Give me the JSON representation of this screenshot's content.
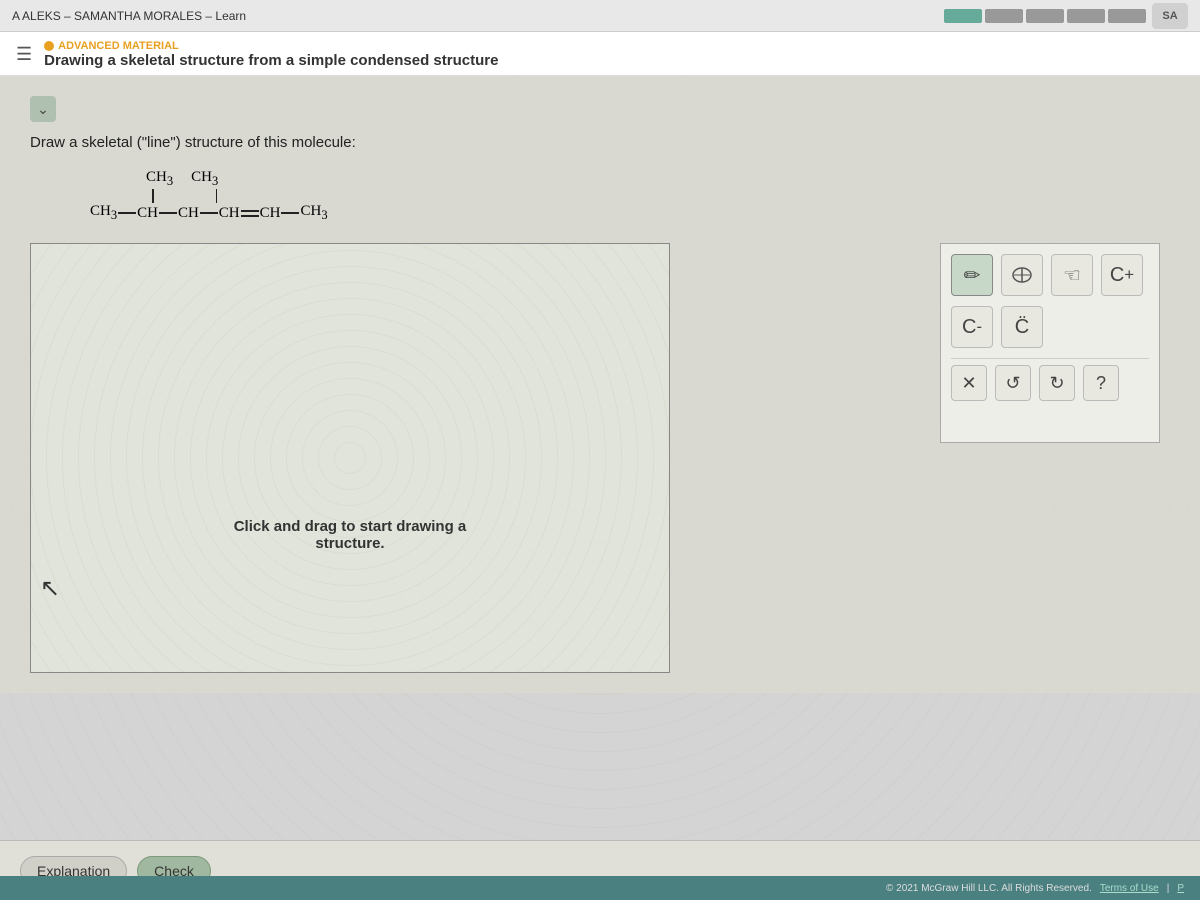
{
  "topbar": {
    "title": "A  ALEKS – SAMANTHA MORALES – Learn",
    "sa_label": "SA"
  },
  "header": {
    "hamburger": "☰",
    "advanced_label": "ADVANCED MATERIAL",
    "lesson_title": "Drawing a skeletal structure from a simple condensed structure"
  },
  "question": {
    "prompt": "Draw a skeletal (\"line\") structure of this molecule:",
    "molecule_label": "CH₃—CH—CH—CH═CH—CH₃",
    "molecule_top1": "CH₃",
    "molecule_top2": "CH₃",
    "canvas_instruction_line1": "Click and drag to start drawing a",
    "canvas_instruction_line2": "structure."
  },
  "toolbar": {
    "pencil_icon": "✏",
    "eraser_icon": "⌦",
    "hand_icon": "☜",
    "cplus_icon": "C⁺",
    "cminus_icon": "C⁻",
    "cdots_icon": "C̈",
    "x_icon": "×",
    "undo_icon": "↺",
    "redo_icon": "↻",
    "help_icon": "?"
  },
  "buttons": {
    "explanation": "Explanation",
    "check": "Check"
  },
  "footer": {
    "copyright": "© 2021 McGraw Hill LLC. All Rights Reserved.",
    "terms": "Terms of Use",
    "pipe": "|",
    "privacy": "P"
  }
}
